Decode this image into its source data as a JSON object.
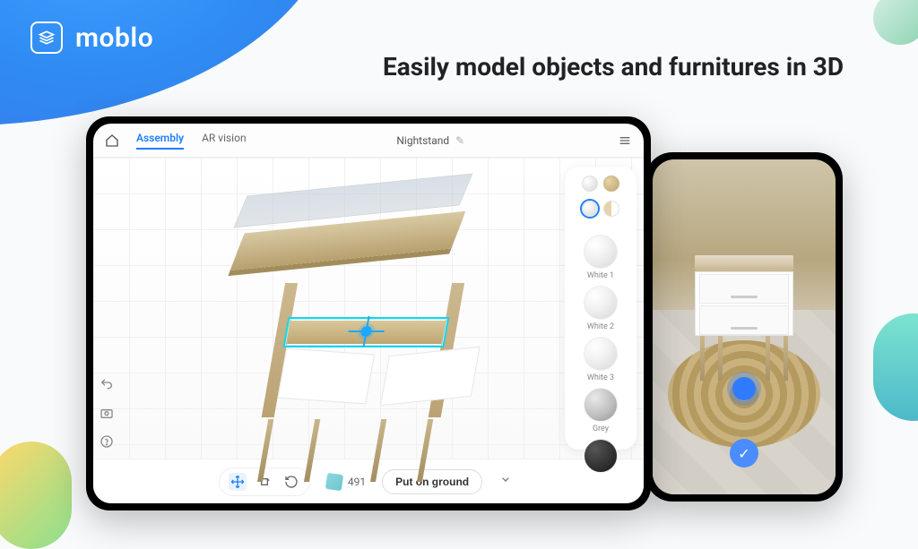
{
  "brand": {
    "name": "moblo"
  },
  "headline": "Easily model objects and furnitures in 3D",
  "editor": {
    "tabs": {
      "assembly": "Assembly",
      "ar": "AR vision"
    },
    "document_title": "Nightstand",
    "part_count": "491",
    "put_on_ground": "Put on ground"
  },
  "swatches": {
    "white1": "White 1",
    "white2": "White 2",
    "white3": "White 3",
    "grey": "Grey"
  }
}
